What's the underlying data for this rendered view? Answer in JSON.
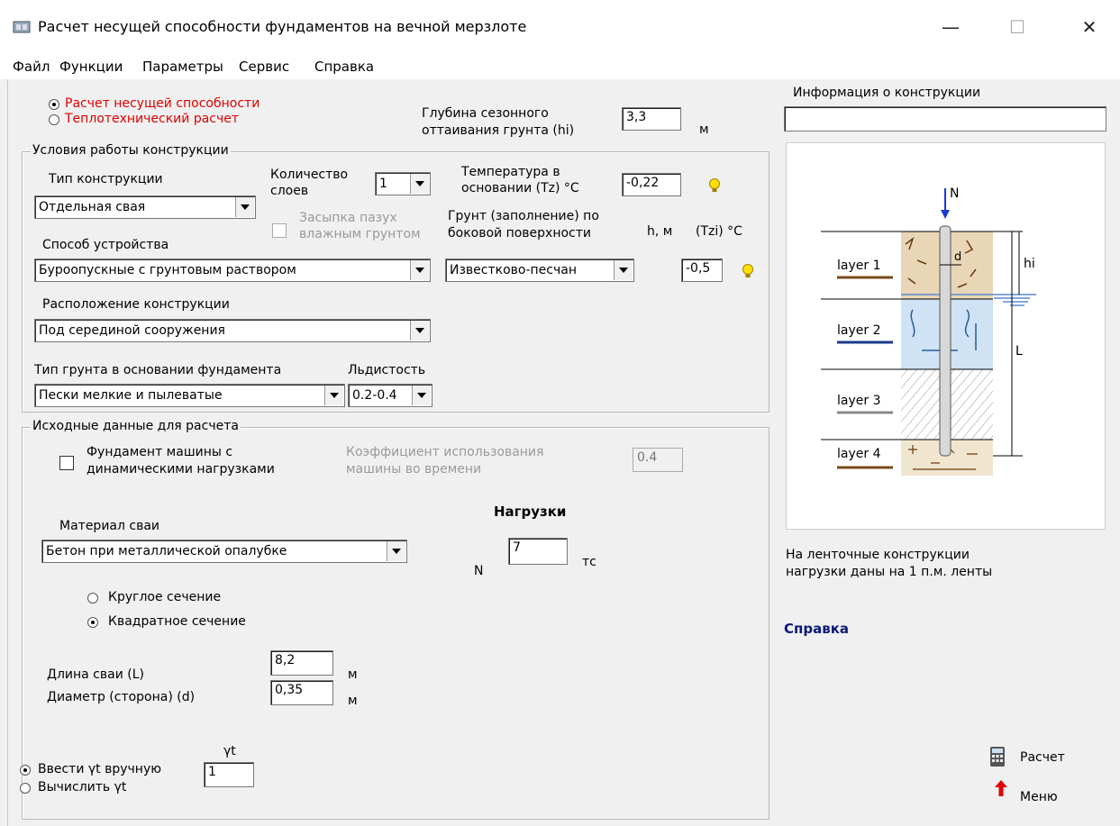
{
  "window": {
    "title": "Расчет несущей способности фундаментов на вечной мерзлоте",
    "minimize": "—",
    "maximize": "☐",
    "close": "✕"
  },
  "menu": [
    "Файл",
    "Функции",
    "Параметры",
    "Сервис",
    "Справка"
  ],
  "calc_mode": {
    "options": [
      "Расчет несущей способности",
      "Теплотехнический расчет"
    ],
    "selected": 0,
    "color": "#e00000"
  },
  "thaw_depth": {
    "label_line1": "Глубина сезонного",
    "label_line2": "оттаивания грунта (hi)",
    "value": "3,3",
    "unit": "м"
  },
  "work_conditions": {
    "legend": "Условия работы конструкции",
    "construction_type": {
      "label": "Тип конструкции",
      "value": "Отдельная свая"
    },
    "layers_count": {
      "label_line1": "Количество",
      "label_line2": "слоев",
      "value": "1"
    },
    "backfill": {
      "label_line1": "Засыпка пазух",
      "label_line2": "влажным грунтом",
      "checked": false,
      "enabled": false
    },
    "temperature": {
      "label_line1": "Температура в",
      "label_line2": "основании (Tz) °C",
      "value": "-0,22"
    },
    "side_soil": {
      "label_line1": "Грунт (заполнение) по",
      "label_line2": "боковой поверхности",
      "h_label": "h, м",
      "t_label": "(Tzi) °C",
      "value": "Известково-песчан",
      "tzi_value": "-0,5"
    },
    "method": {
      "label": "Способ устройства",
      "value": "Буроопускные с грунтовым раствором"
    },
    "location": {
      "label": "Расположение конструкции",
      "value": "Под серединой сооружения"
    },
    "base_soil": {
      "label": "Тип грунта в основании фундамента",
      "value": "Пески мелкие и пылеватые"
    },
    "ice_content": {
      "label": "Льдистость",
      "value": "0.2-0.4"
    }
  },
  "input_data": {
    "legend": "Исходные данные для расчета",
    "dynamic": {
      "label_line1": "Фундамент машины с",
      "label_line2": "динамическими нагрузками",
      "checked": false
    },
    "usage_coef": {
      "label_line1": "Коэффициент использования",
      "label_line2": "машины во времени",
      "value": "0.4"
    },
    "loads_title": "Нагрузки",
    "n_label": "N",
    "n_value": "7",
    "n_unit": "тс",
    "pile_material": {
      "label": "Материал сваи",
      "value": "Бетон при металлической опалубке"
    },
    "section": {
      "options": [
        "Круглое сечение",
        "Квадратное сечение"
      ],
      "selected": 1
    },
    "pile_length": {
      "label": "Длина сваи (L)",
      "value": "8,2",
      "unit": "м"
    },
    "pile_diameter": {
      "label": "Диаметр (сторона) (d)",
      "value": "0,35",
      "unit": "м"
    },
    "gamma": {
      "options": [
        "Ввести γt вручную",
        "Вычислить γt"
      ],
      "selected": 0,
      "label": "γt",
      "value": "1"
    }
  },
  "info": {
    "label": "Информация о конструкции",
    "value": ""
  },
  "diagram": {
    "N": "N",
    "d": "d",
    "hi": "hi",
    "L": "L",
    "layers": [
      "layer 1",
      "layer 2",
      "layer 3",
      "layer 4"
    ],
    "layer_colors": [
      "#7a4a1a",
      "#1a3a8a",
      "#888888",
      "#7a4a1a"
    ]
  },
  "note": {
    "line1": "На ленточные конструкции",
    "line2": "нагрузки даны на 1 п.м. ленты"
  },
  "help_link": "Справка",
  "buttons": {
    "calc": "Расчет",
    "menu": "Меню"
  }
}
